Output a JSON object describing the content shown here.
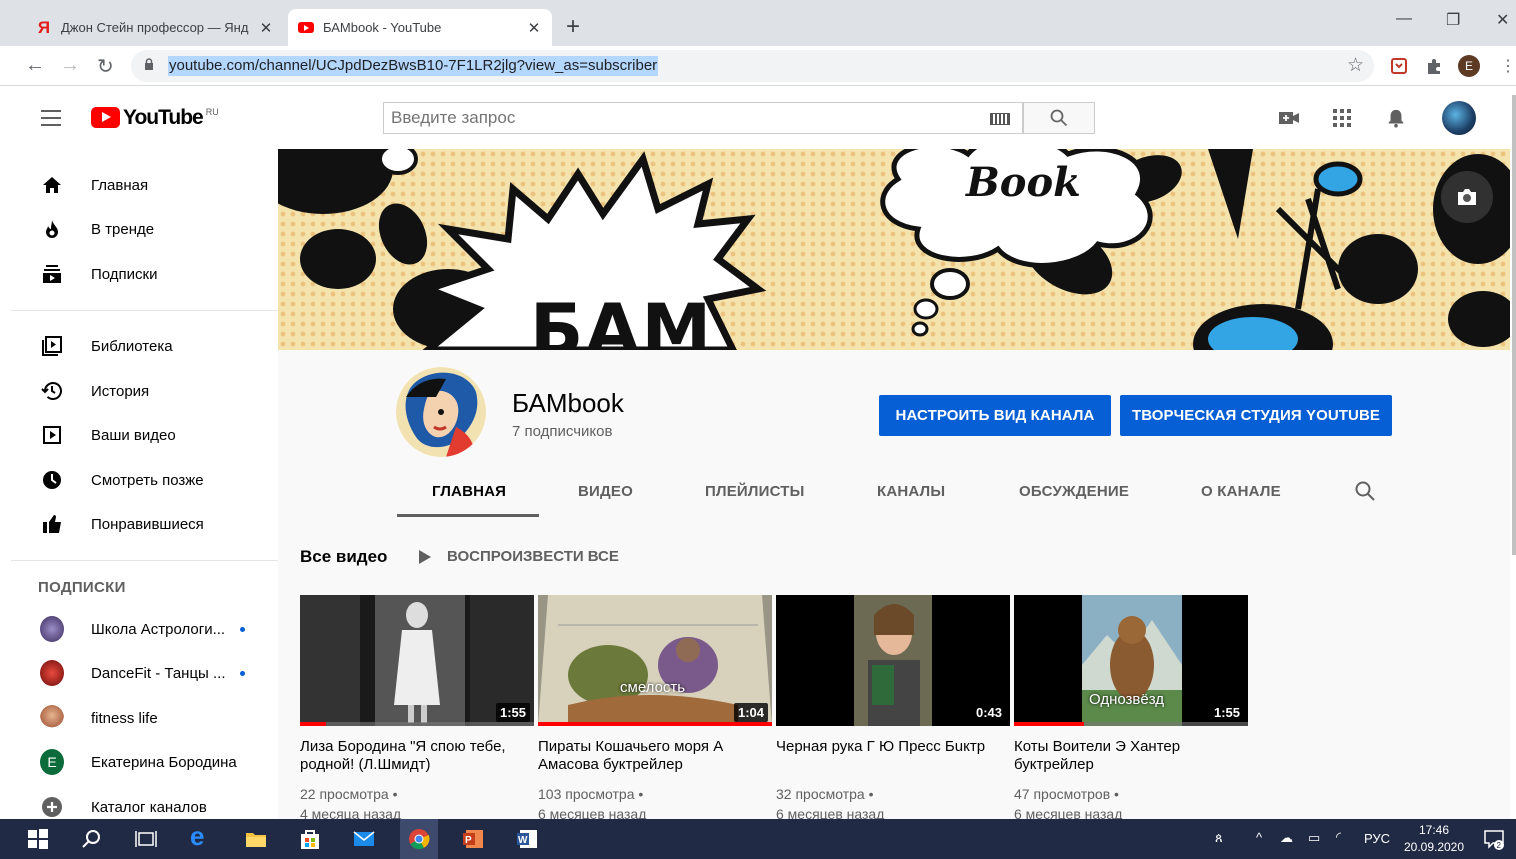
{
  "browser": {
    "tabs": [
      {
        "title": "Джон Стейн профессор — Янд"
      },
      {
        "title": "БАМbook - YouTube"
      }
    ],
    "url": "youtube.com/channel/UCJpdDezBwsB10-7F1LR2jlg?view_as=subscriber",
    "profile_letter": "E"
  },
  "masthead": {
    "logo_text": "YouTube",
    "region": "RU",
    "search_placeholder": "Введите запрос"
  },
  "sidebar": {
    "main_items": [
      {
        "label": "Главная",
        "icon": "home-icon"
      },
      {
        "label": "В тренде",
        "icon": "trending-icon"
      },
      {
        "label": "Подписки",
        "icon": "subscriptions-icon"
      }
    ],
    "library_items": [
      {
        "label": "Библиотека",
        "icon": "library-icon"
      },
      {
        "label": "История",
        "icon": "history-icon"
      },
      {
        "label": "Ваши видео",
        "icon": "your-videos-icon"
      },
      {
        "label": "Смотреть позже",
        "icon": "watch-later-icon"
      },
      {
        "label": "Понравившиеся",
        "icon": "liked-icon"
      }
    ],
    "subscriptions_heading": "ПОДПИСКИ",
    "subscriptions": [
      {
        "label": "Школа Астрологи...",
        "new": true
      },
      {
        "label": "DanceFit - Танцы ...",
        "new": true
      },
      {
        "label": "fitness life",
        "new": false
      },
      {
        "label": "Екатерина Бородина",
        "new": false,
        "avatar_letter": "E"
      },
      {
        "label": "Каталог каналов",
        "new": false
      }
    ]
  },
  "banner": {
    "word_top": "Book",
    "word_bottom": "БАМ"
  },
  "channel": {
    "name": "БАМbook",
    "subscribers": "7 подписчиков",
    "customize_button": "НАСТРОИТЬ ВИД КАНАЛА",
    "studio_button": "ТВОРЧЕСКАЯ СТУДИЯ YOUTUBE",
    "tabs": [
      "ГЛАВНАЯ",
      "ВИДЕО",
      "ПЛЕЙЛИСТЫ",
      "КАНАЛЫ",
      "ОБСУЖДЕНИЕ",
      "О КАНАЛЕ"
    ],
    "active_tab": "ГЛАВНАЯ"
  },
  "shelf": {
    "title": "Все видео",
    "play_all": "ВОСПРОИЗВЕСТИ ВСЕ"
  },
  "videos": [
    {
      "title": "Лиза Бородина \"Я спою тебе, родной! (Л.Шмидт)",
      "duration": "1:55",
      "views": "22 просмотра",
      "age": "4 месяца назад",
      "watched_fraction": 0.11,
      "overlay": ""
    },
    {
      "title": "Пираты Кошачьего моря А Амасова буктрейлер",
      "duration": "1:04",
      "views": "103 просмотра",
      "age": "6 месяцев назад",
      "watched_fraction": 1.0,
      "overlay": "смелость"
    },
    {
      "title": "Черная рука Г Ю Пресс Бuктр",
      "duration": "0:43",
      "views": "32 просмотра",
      "age": "6 месяцев назад",
      "watched_fraction": 0,
      "overlay": ""
    },
    {
      "title": "Коты Воители Э Хантер буктрейлер",
      "duration": "1:55",
      "views": "47 просмотров",
      "age": "6 месяцев назад",
      "watched_fraction": 0.3,
      "overlay": "Однозвёзд"
    }
  ],
  "taskbar": {
    "language": "РУС",
    "time": "17:46",
    "date": "20.09.2020",
    "notification_count": "2"
  },
  "colors": {
    "youtube_red": "#ff0000",
    "button_blue": "#065fd4",
    "taskbar": "#202a44"
  }
}
